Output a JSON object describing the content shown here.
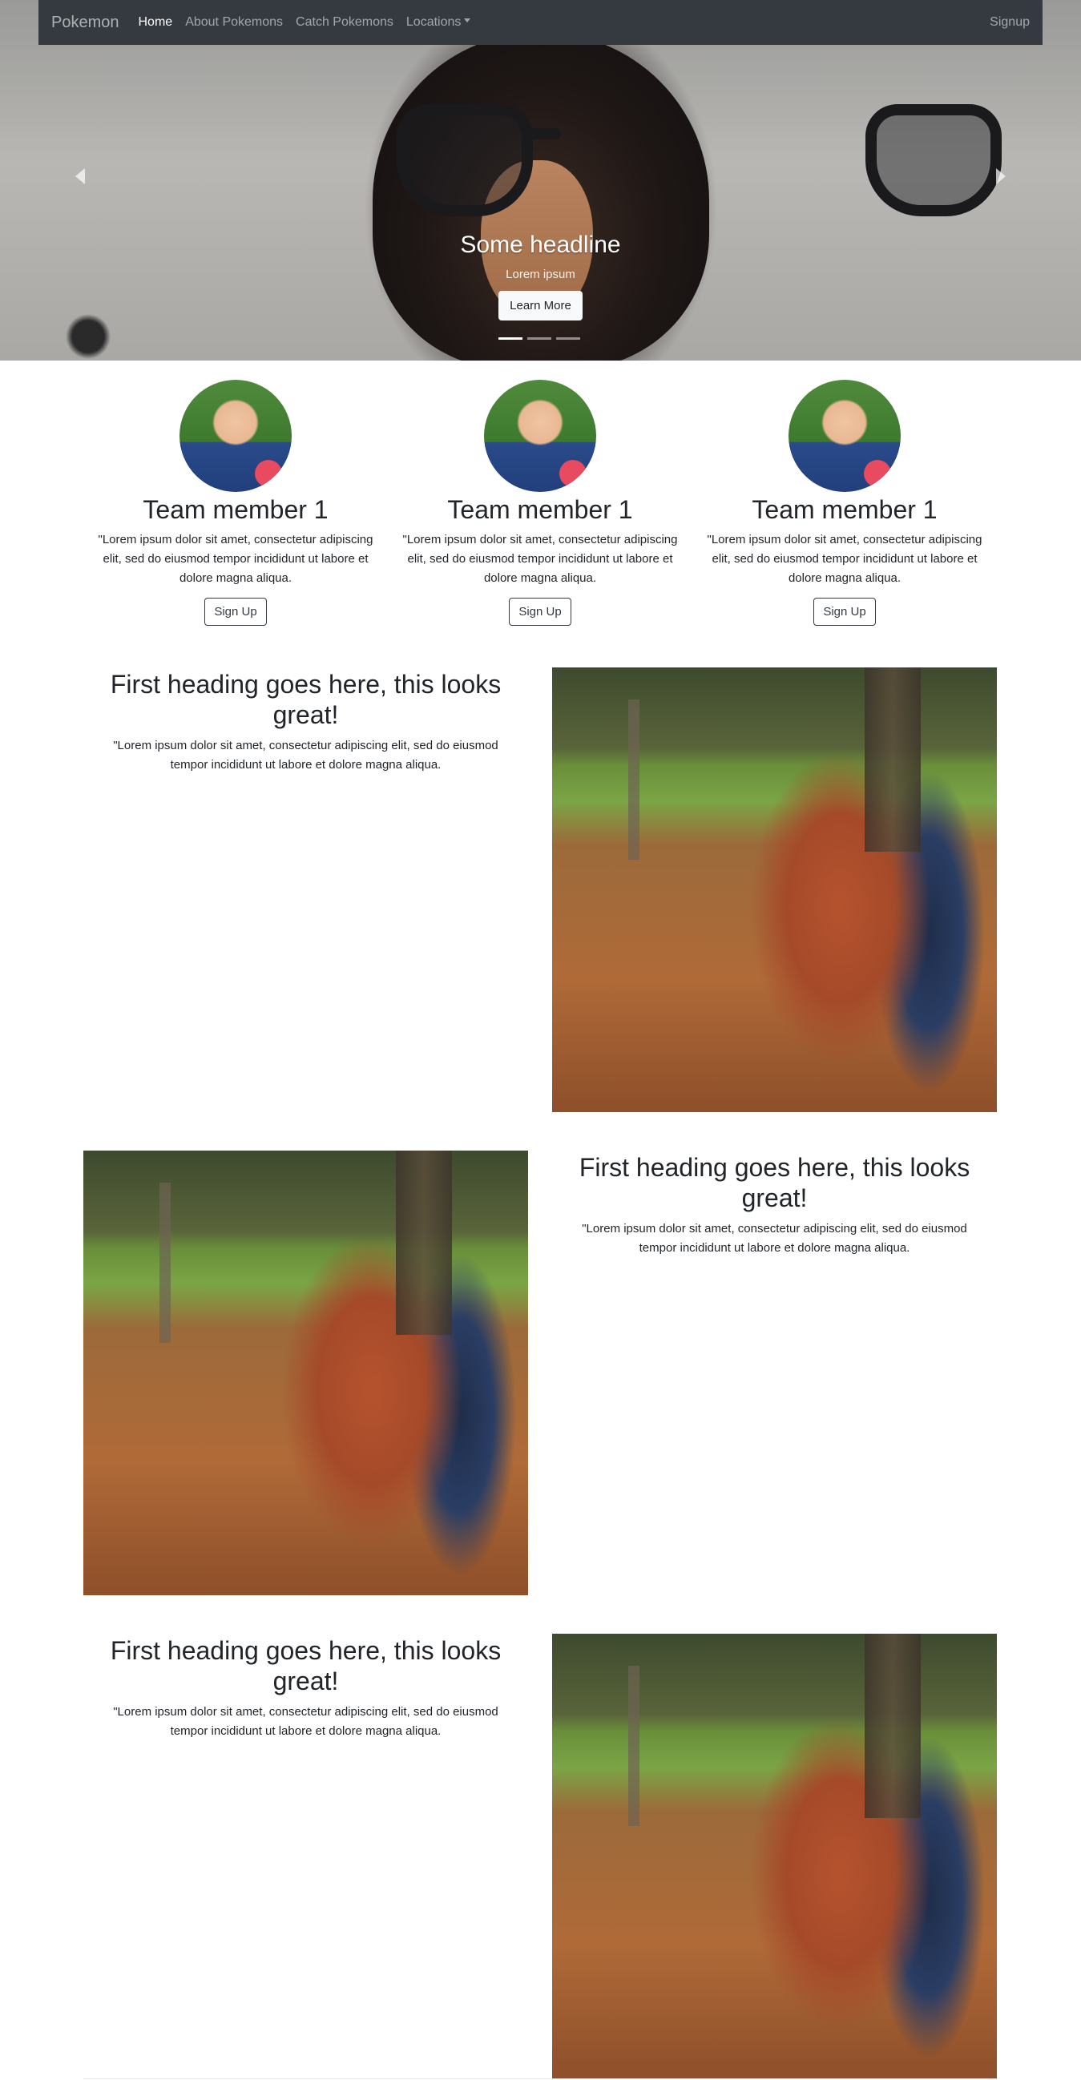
{
  "navbar": {
    "brand": "Pokemon",
    "links": [
      "Home",
      "About Pokemons",
      "Catch Pokemons",
      "Locations"
    ],
    "signup": "Signup"
  },
  "carousel": {
    "headline": "Some headline",
    "subtext": "Lorem ipsum",
    "button": "Learn More",
    "slides": 3,
    "active_slide": 1
  },
  "team": [
    {
      "name": "Team member 1",
      "text": "\"Lorem ipsum dolor sit amet, consectetur adipiscing elit, sed do eiusmod tempor incididunt ut labore et dolore magna aliqua.",
      "button": "Sign Up"
    },
    {
      "name": "Team member 1",
      "text": "\"Lorem ipsum dolor sit amet, consectetur adipiscing elit, sed do eiusmod tempor incididunt ut labore et dolore magna aliqua.",
      "button": "Sign Up"
    },
    {
      "name": "Team member 1",
      "text": "\"Lorem ipsum dolor sit amet, consectetur adipiscing elit, sed do eiusmod tempor incididunt ut labore et dolore magna aliqua.",
      "button": "Sign Up"
    }
  ],
  "features": [
    {
      "heading": "First heading goes here, this looks great!",
      "text": "\"Lorem ipsum dolor sit amet, consectetur adipiscing elit, sed do eiusmod tempor incididunt ut labore et dolore magna aliqua."
    },
    {
      "heading": "First heading goes here, this looks great!",
      "text": "\"Lorem ipsum dolor sit amet, consectetur adipiscing elit, sed do eiusmod tempor incididunt ut labore et dolore magna aliqua."
    },
    {
      "heading": "First heading goes here, this looks great!",
      "text": "\"Lorem ipsum dolor sit amet, consectetur adipiscing elit, sed do eiusmod tempor incididunt ut labore et dolore magna aliqua."
    }
  ]
}
